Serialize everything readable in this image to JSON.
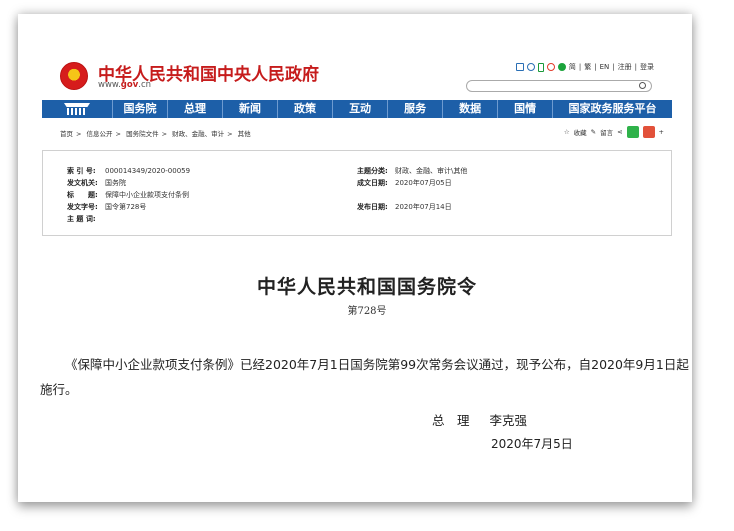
{
  "header": {
    "title": "中华人民共和国中央人民政府",
    "url_prefix": "www.",
    "url_domain": "gov",
    "url_suffix": ".cn",
    "toplinks": [
      "简",
      "繁",
      "EN",
      "注册",
      "登录"
    ],
    "icons": [
      "mail-icon",
      "mobile-icon",
      "phone-icon",
      "weibo-icon",
      "wechat-icon"
    ]
  },
  "nav": {
    "items": [
      "国务院",
      "总理",
      "新闻",
      "政策",
      "互动",
      "服务",
      "数据",
      "国情",
      "国家政务服务平台"
    ]
  },
  "breadcrumb": [
    "首页",
    "信息公开",
    "国务院文件",
    "财政、金融、审计",
    "其他"
  ],
  "share": {
    "favorite": "收藏",
    "font": "留言"
  },
  "info": {
    "index_label": "索 引 号:",
    "index_value": "000014349/2020-00059",
    "category_label": "主题分类:",
    "category_value": "财政、金融、审计\\其他",
    "issuer_label": "发文机关:",
    "issuer_value": "国务院",
    "written_label": "成文日期:",
    "written_value": "2020年07月05日",
    "title_label": "标　　题:",
    "title_value": "保障中小企业款项支付条例",
    "docno_label": "发文字号:",
    "docno_value": "国令第728号",
    "publish_label": "发布日期:",
    "publish_value": "2020年07月14日",
    "subject_label": "主 题 词:",
    "subject_value": ""
  },
  "document": {
    "title": "中华人民共和国国务院令",
    "number": "第728号",
    "body": "《保障中小企业款项支付条例》已经2020年7月1日国务院第99次常务会议通过，现予公布，自2020年9月1日起施行。",
    "sign_role": "总　理",
    "sign_name": "李克强",
    "date": "2020年7月5日"
  }
}
